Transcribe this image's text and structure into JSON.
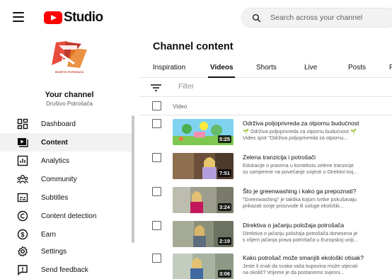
{
  "header": {
    "app_name": "Studio",
    "search_placeholder": "Search across your channel"
  },
  "sidebar": {
    "logo_caption": "DRUŠTVO POTROŠAČA",
    "your_channel_label": "Your channel",
    "channel_name": "Društvo Potrošača",
    "items": [
      {
        "label": "Dashboard",
        "icon": "dashboard-icon"
      },
      {
        "label": "Content",
        "icon": "content-icon",
        "active": true
      },
      {
        "label": "Analytics",
        "icon": "analytics-icon"
      },
      {
        "label": "Community",
        "icon": "community-icon"
      },
      {
        "label": "Subtitles",
        "icon": "subtitles-icon"
      },
      {
        "label": "Content detection",
        "icon": "copyright-icon"
      },
      {
        "label": "Earn",
        "icon": "earn-icon"
      },
      {
        "label": "Settings",
        "icon": "gear-icon"
      },
      {
        "label": "Send feedback",
        "icon": "feedback-icon"
      }
    ]
  },
  "main": {
    "title": "Channel content",
    "tabs": [
      "Inspiration",
      "Videos",
      "Shorts",
      "Live",
      "Posts",
      "P"
    ],
    "active_tab": "Videos",
    "filter_placeholder": "Filter",
    "column_video": "Video",
    "videos": [
      {
        "title": "Održiva poljoprivreda za otpornu budućnost",
        "desc": "🌱 Održiva poljoprivreda za otpornu budućnost 🌱\nVideo spot \"Održiva poljoprivreda za otpornu...",
        "duration": "5:25"
      },
      {
        "title": "Zelena tranzicija i potrošači",
        "desc": "Edukacije o pravima u kontekstu zelene tranzicije\nsu usmjerene na povećanje svijesti o Direktivi koj...",
        "duration": "7:51"
      },
      {
        "title": "Što je greenwashing i kako ga prepoznati?",
        "desc": "\"Greenwashing\" je taktika kojom tvrtke pokušavaju\nprikazati svoje proizvode ili usluge ekološki...",
        "duration": "3:24"
      },
      {
        "title": "Direktiva o jačanju položaja potrošača",
        "desc": "Direktiva o jačanju položaja potrošača donesena je\ns ciljem jačanja prava potrošača u Europskoj uniji...",
        "duration": "2:19"
      },
      {
        "title": "Kako potrošač može smanjiti ekološki otisak?",
        "desc": "Jeste li znali da svaka vaša kupovina može utjecati\nna okoliš? Vrijeme je da postanemo svjesni...",
        "duration": "3:06"
      }
    ]
  }
}
